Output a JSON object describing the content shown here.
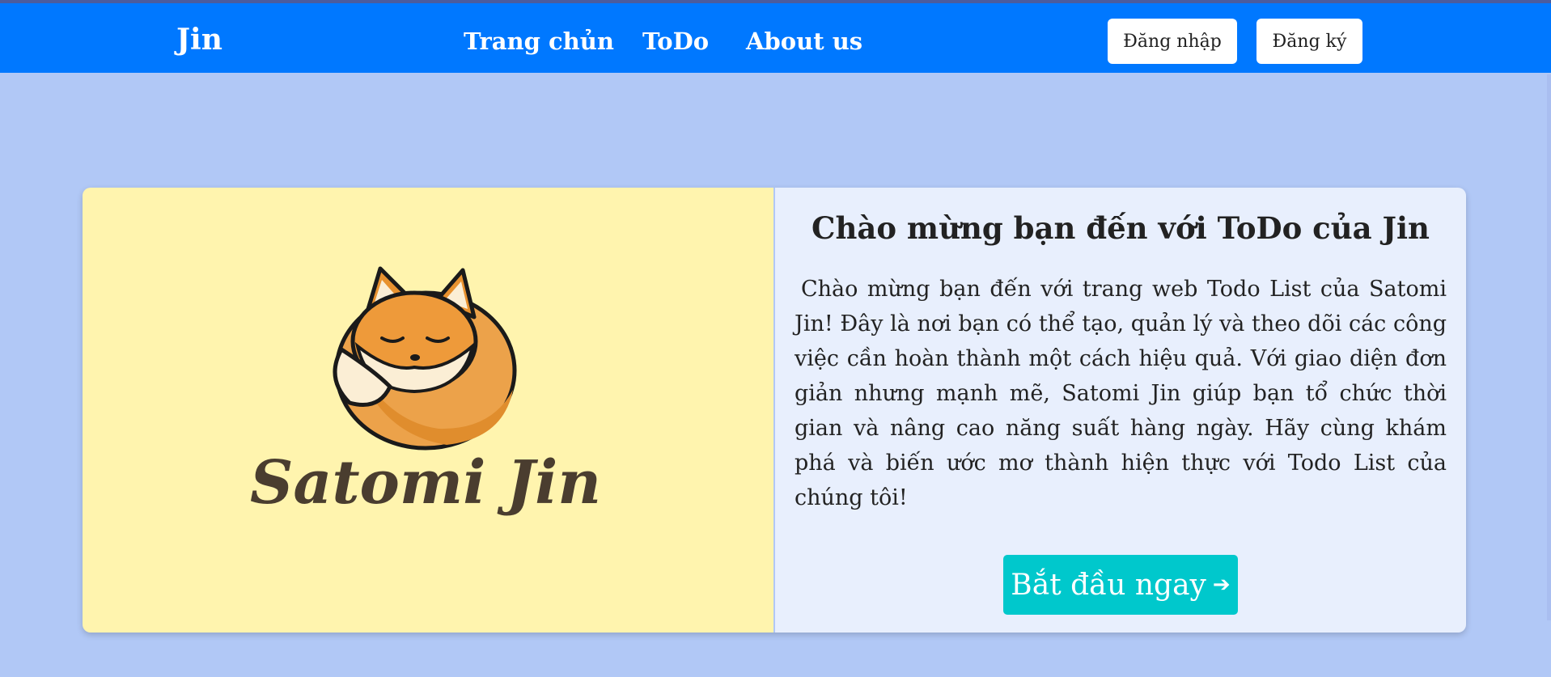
{
  "navbar": {
    "brand": "Jin",
    "links": [
      "Trang chủn",
      "ToDo",
      "About us"
    ],
    "login_label": "Đăng nhập",
    "register_label": "Đăng ký",
    "color": "#0078ff"
  },
  "hero": {
    "logo_text": "Satomi Jin",
    "logo_icon": "sleeping-fox-icon",
    "title": "Chào mừng bạn đến với ToDo của Jin",
    "description": "Chào mừng bạn đến với trang web Todo List của Satomi Jin! Đây là nơi bạn có thể tạo, quản lý và theo dõi các công việc cần hoàn thành một cách hiệu quả. Với giao diện đơn giản nhưng mạnh mẽ, Satomi Jin giúp bạn tổ chức thời gian và nâng cao năng suất hàng ngày. Hãy cùng khám phá và biến ước mơ thành hiện thực với Todo List của chúng tôi!",
    "cta_label": "Bắt đầu ngay",
    "cta_icon": "arrow-right-icon",
    "cta_color": "#00c8cc",
    "left_panel_color": "#fff4ae",
    "right_panel_color": "#e8effd"
  },
  "page_background": "#b1c8f6"
}
